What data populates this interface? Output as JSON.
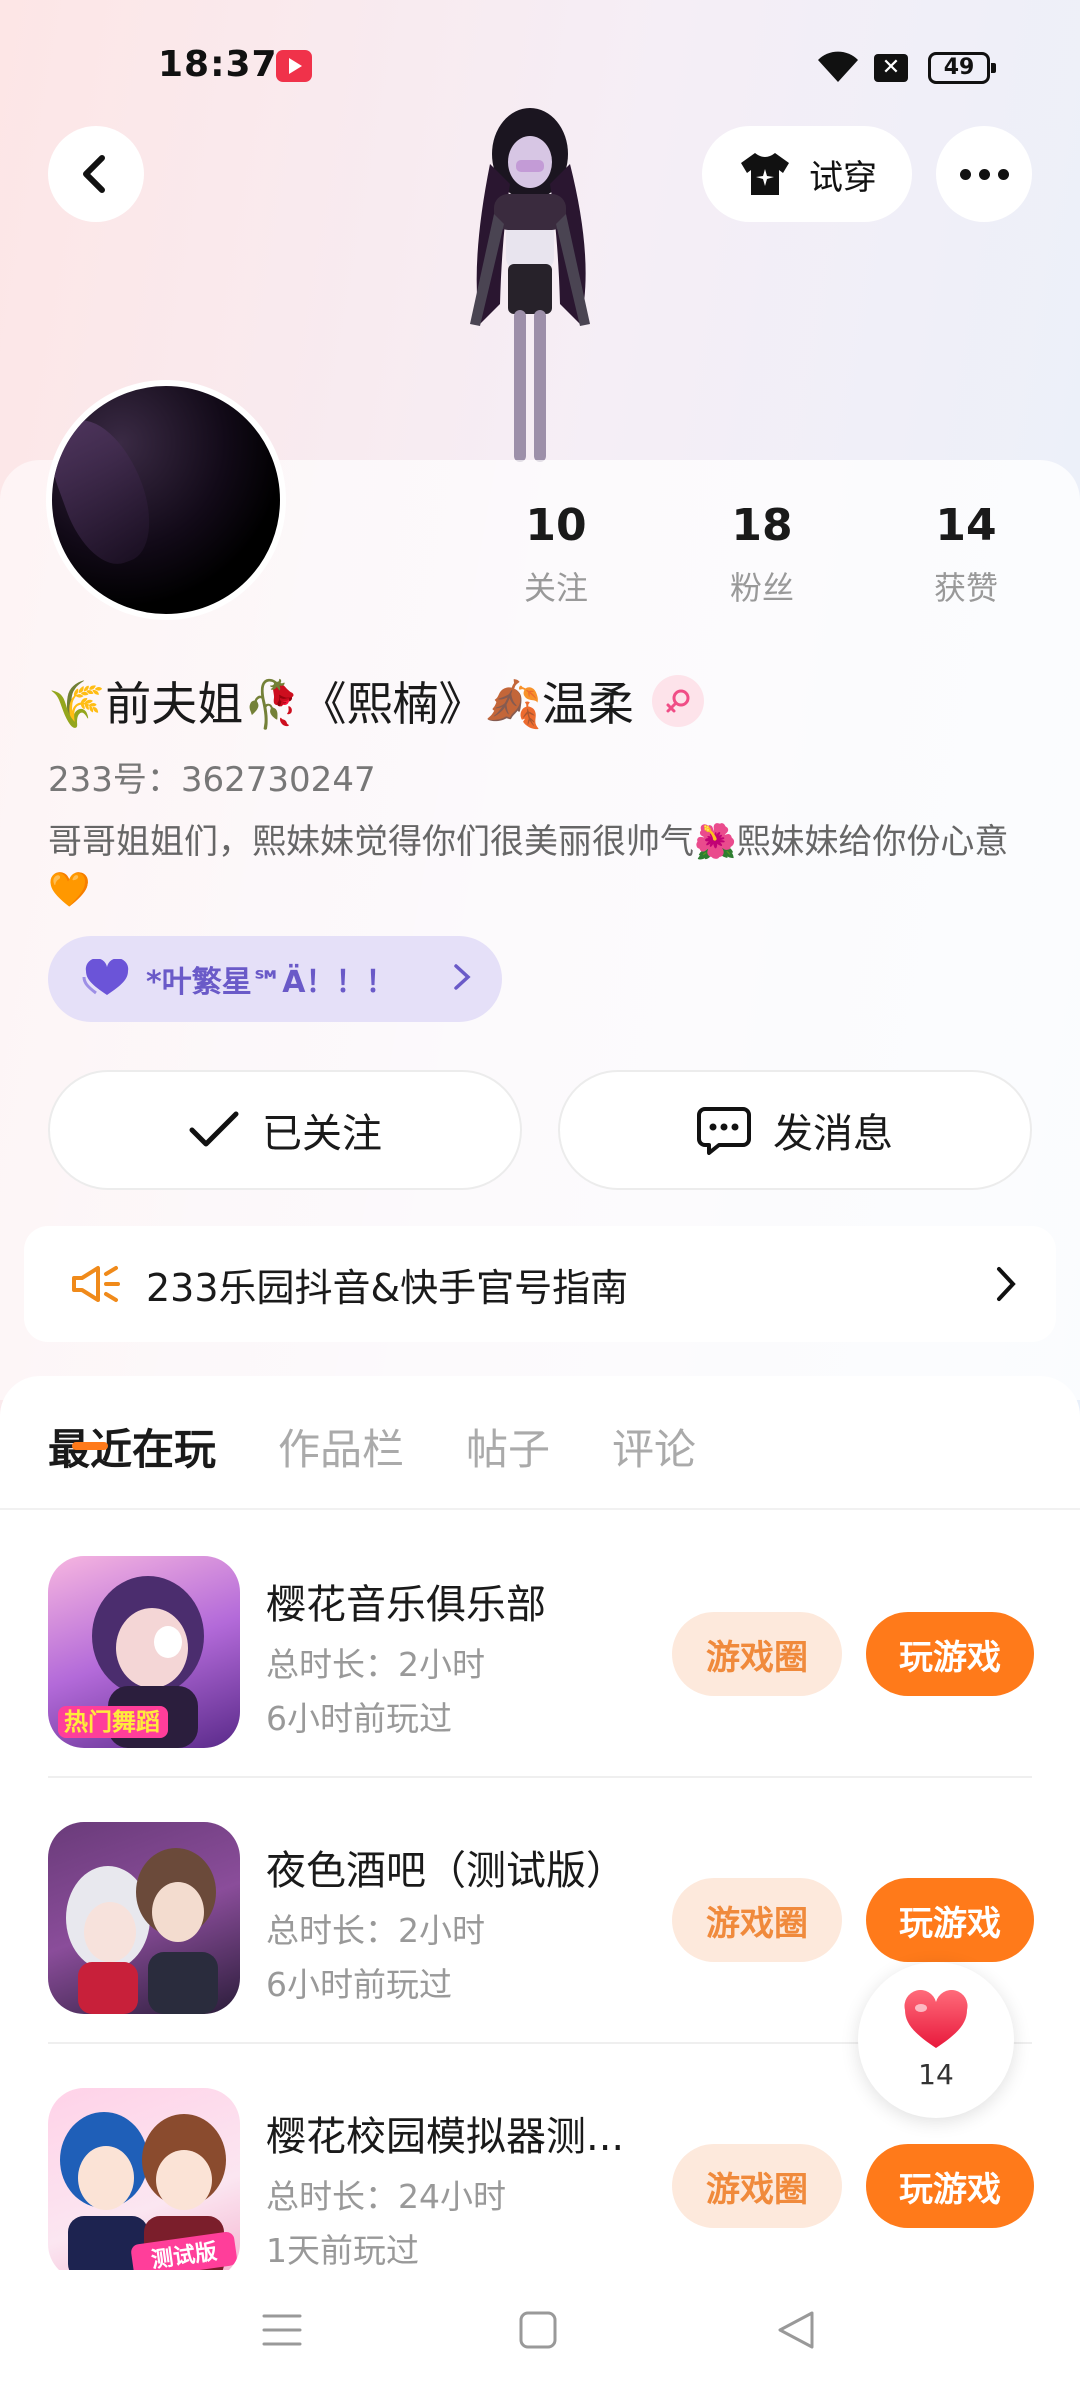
{
  "status_bar": {
    "time": "18:37",
    "battery": "49",
    "sim_badge": "✕"
  },
  "header": {
    "tryon_label": "试穿"
  },
  "profile": {
    "stats": [
      {
        "value": "10",
        "label": "关注"
      },
      {
        "value": "18",
        "label": "粉丝"
      },
      {
        "value": "14",
        "label": "获赞"
      }
    ],
    "nickname": "🌾前夫姐🥀《熙楠》🍂温柔",
    "user_id": "233号：362730247",
    "bio": "哥哥姐姐们，熙妹妹觉得你们很美丽很帅气🌺熙妹妹给你份心意🧡",
    "guild": "*叶繁星℠Ä！！！",
    "follow_label": "已关注",
    "message_label": "发消息",
    "notice": "233乐园抖音&快手官号指南"
  },
  "tabs": [
    "最近在玩",
    "作品栏",
    "帖子",
    "评论"
  ],
  "games": [
    {
      "name": "樱花音乐俱乐部",
      "duration": "总时长：2小时",
      "last_played": "6小时前玩过",
      "circle_label": "游戏圈",
      "play_label": "玩游戏",
      "icon_badge": "热门舞蹈"
    },
    {
      "name": "夜色酒吧（测试版）",
      "duration": "总时长：2小时",
      "last_played": "6小时前玩过",
      "circle_label": "游戏圈",
      "play_label": "玩游戏",
      "icon_badge": ""
    },
    {
      "name": "樱花校园模拟器测...",
      "duration": "总时长：24小时",
      "last_played": "1天前玩过",
      "circle_label": "游戏圈",
      "play_label": "玩游戏",
      "icon_badge": "测试版"
    }
  ],
  "like_fab": {
    "count": "14"
  },
  "colors": {
    "accent": "#ff7a1a",
    "accent_light": "#fde9dc",
    "guild_bg": "#e5e0f8",
    "guild_text": "#6a5ac8"
  },
  "icons": [
    "back-arrow-icon",
    "tshirt-icon",
    "more-dots-icon",
    "check-icon",
    "chat-bubble-icon",
    "megaphone-icon",
    "chevron-right-icon",
    "heart-icon",
    "wifi-icon",
    "menu-icon",
    "home-square-icon",
    "back-triangle-icon"
  ]
}
